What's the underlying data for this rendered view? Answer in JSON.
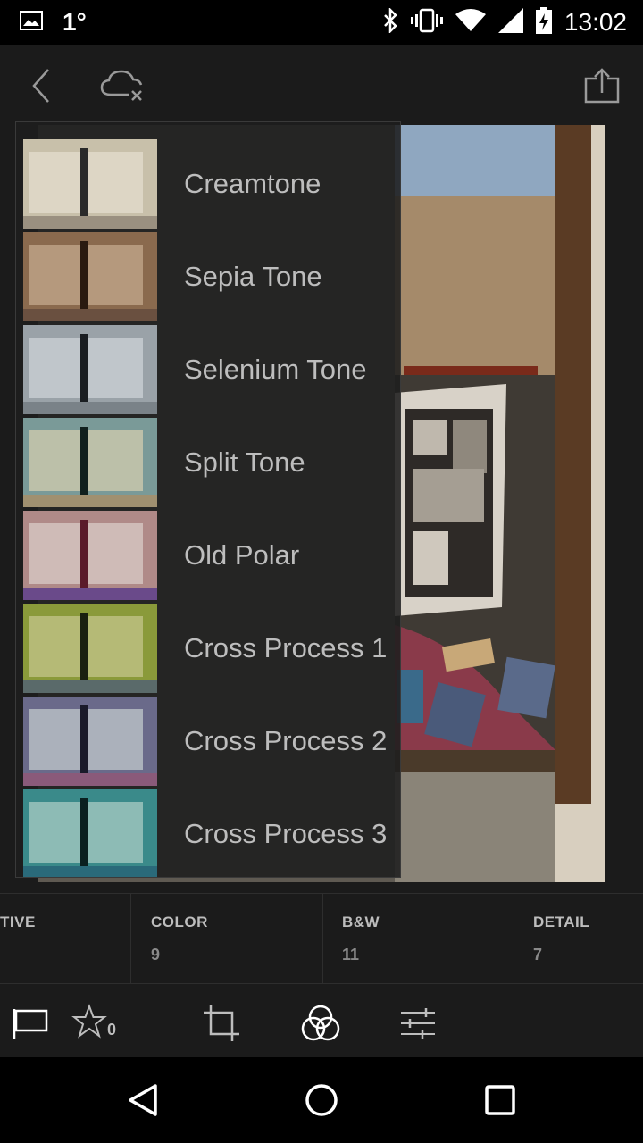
{
  "status_bar": {
    "temperature": "1°",
    "time": "13:02",
    "icons": [
      "image-notification-icon",
      "bluetooth-icon",
      "vibrate-icon",
      "wifi-icon",
      "signal-icon",
      "battery-charging-icon"
    ]
  },
  "app_bar": {
    "icons": [
      "back-icon",
      "cloud-off-icon",
      "share-icon"
    ]
  },
  "presets": [
    {
      "label": "Creamtone",
      "tint": "#c8c0aa"
    },
    {
      "label": "Sepia Tone",
      "tint": "#8a6a4e"
    },
    {
      "label": "Selenium Tone",
      "tint": "#9aa2a8"
    },
    {
      "label": "Split Tone",
      "tint": "#7a9a98"
    },
    {
      "label": "Old Polar",
      "tint": "#b08a88"
    },
    {
      "label": "Cross Process 1",
      "tint": "#8a9a3a"
    },
    {
      "label": "Cross Process 2",
      "tint": "#6a6a8a"
    },
    {
      "label": "Cross Process 3",
      "tint": "#3a8a8a"
    }
  ],
  "categories": [
    {
      "name": "TIVE",
      "count": ""
    },
    {
      "name": "COLOR",
      "count": "9"
    },
    {
      "name": "B&W",
      "count": "11"
    },
    {
      "name": "DETAIL",
      "count": "7"
    }
  ],
  "toolbar": {
    "rating_count": "0",
    "icons": [
      "flag-icon",
      "star-icon",
      "crop-icon",
      "presets-icon",
      "adjust-icon"
    ]
  },
  "nav_bar": {
    "icons": [
      "nav-back-icon",
      "nav-home-icon",
      "nav-recents-icon"
    ]
  },
  "colors": {
    "background": "#1b1b1b",
    "panel": "#1e1e1e",
    "label": "#bdbdbd",
    "muted": "#8a8a8a"
  }
}
